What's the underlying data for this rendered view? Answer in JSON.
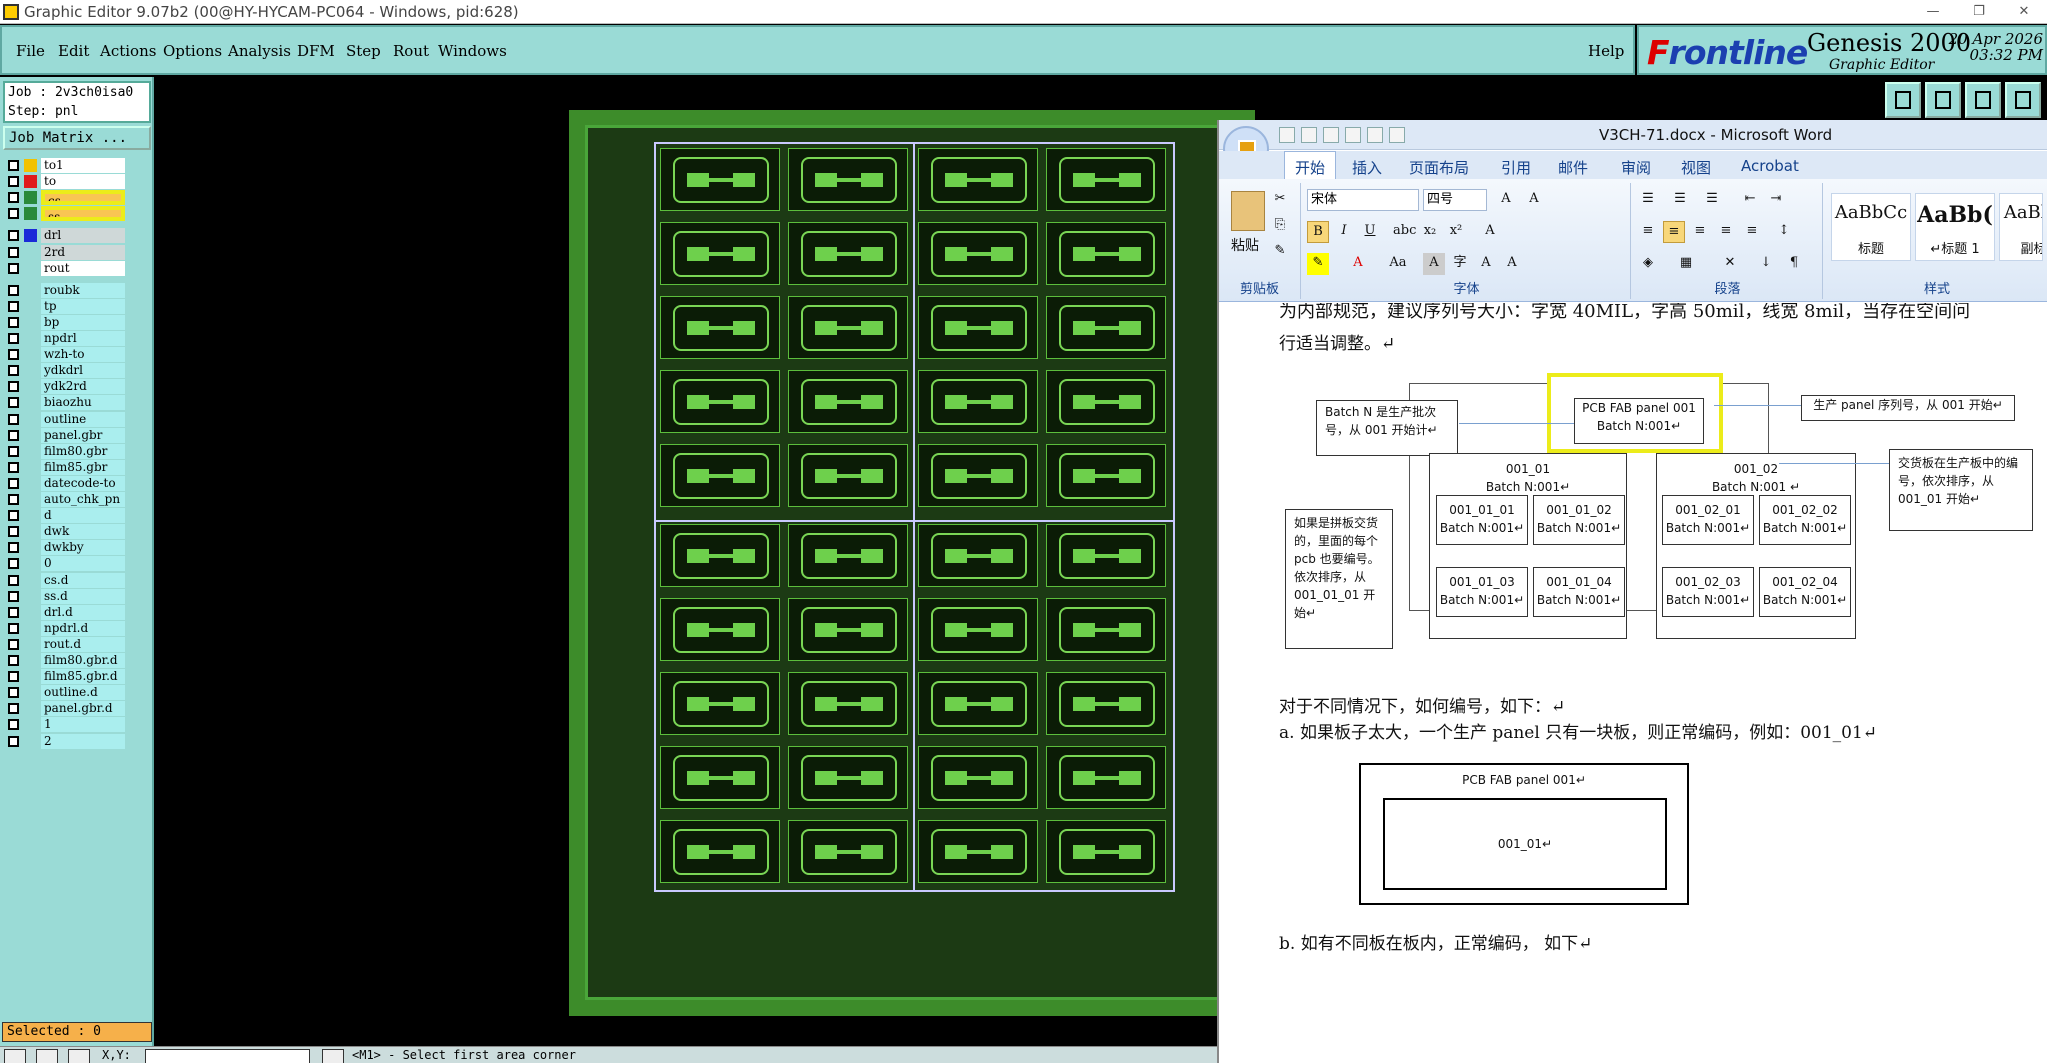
{
  "window": {
    "title": "Graphic Editor 9.07b2 (00@HY-HYCAM-PC064 - Windows, pid:628)"
  },
  "menu": [
    "File",
    "Edit",
    "Actions",
    "Options",
    "Analysis",
    "DFM",
    "Step",
    "Rout",
    "Windows"
  ],
  "help": "Help",
  "brand": {
    "logo_part1": "F",
    "logo_part2": "rontline",
    "product": "Genesis 2000",
    "subtitle": "Graphic Editor",
    "date": "20 Apr 2026",
    "time": "03:32 PM"
  },
  "job": {
    "job_line": "Job : 2v3ch0isa0",
    "step_line": "Step: pnl",
    "matrix_button": "Job Matrix ..."
  },
  "layers": [
    {
      "name": "to1",
      "color": "#f2c200",
      "style": "hl"
    },
    {
      "name": "to",
      "color": "#e01b1b",
      "style": "hl"
    },
    {
      "name": "cs",
      "color": "#2a8a3a",
      "style": "yel"
    },
    {
      "name": "ss",
      "color": "#2a8a3a",
      "style": "yel"
    },
    {
      "name": "drl",
      "color": "#1a2ad8",
      "style": "grey"
    },
    {
      "name": "2rd",
      "color": "",
      "style": "grey"
    },
    {
      "name": "rout",
      "color": "",
      "style": "hl"
    },
    {
      "name": "roubk",
      "color": "",
      "style": ""
    },
    {
      "name": "tp",
      "color": "",
      "style": ""
    },
    {
      "name": "bp",
      "color": "",
      "style": ""
    },
    {
      "name": "npdrl",
      "color": "",
      "style": ""
    },
    {
      "name": "wzh-to",
      "color": "",
      "style": ""
    },
    {
      "name": "ydkdrl",
      "color": "",
      "style": ""
    },
    {
      "name": "ydk2rd",
      "color": "",
      "style": ""
    },
    {
      "name": "biaozhu",
      "color": "",
      "style": ""
    },
    {
      "name": "outline",
      "color": "",
      "style": ""
    },
    {
      "name": "panel.gbr",
      "color": "",
      "style": ""
    },
    {
      "name": "film80.gbr",
      "color": "",
      "style": ""
    },
    {
      "name": "film85.gbr",
      "color": "",
      "style": ""
    },
    {
      "name": "datecode-to",
      "color": "",
      "style": ""
    },
    {
      "name": "auto_chk_pn",
      "color": "",
      "style": ""
    },
    {
      "name": "d",
      "color": "",
      "style": ""
    },
    {
      "name": "dwk",
      "color": "",
      "style": ""
    },
    {
      "name": "dwkby",
      "color": "",
      "style": ""
    },
    {
      "name": "0",
      "color": "",
      "style": ""
    },
    {
      "name": "cs.d",
      "color": "",
      "style": ""
    },
    {
      "name": "ss.d",
      "color": "",
      "style": ""
    },
    {
      "name": "drl.d",
      "color": "",
      "style": ""
    },
    {
      "name": "npdrl.d",
      "color": "",
      "style": ""
    },
    {
      "name": "rout.d",
      "color": "",
      "style": ""
    },
    {
      "name": "film80.gbr.d",
      "color": "",
      "style": ""
    },
    {
      "name": "film85.gbr.d",
      "color": "",
      "style": ""
    },
    {
      "name": "outline.d",
      "color": "",
      "style": ""
    },
    {
      "name": "panel.gbr.d",
      "color": "",
      "style": ""
    },
    {
      "name": "1",
      "color": "",
      "style": ""
    },
    {
      "name": "2",
      "color": "",
      "style": ""
    }
  ],
  "selected": "Selected : 0",
  "status": {
    "coord_label": "X,Y:",
    "prompt": "<M1> - Select first area corner"
  },
  "word": {
    "title": "V3CH-71.docx - Microsoft Word",
    "tabs": [
      "开始",
      "插入",
      "页面布局",
      "引用",
      "邮件",
      "审阅",
      "视图",
      "Acrobat"
    ],
    "font_name": "宋体",
    "font_size": "四号",
    "paste_label": "粘贴",
    "groups": [
      "剪贴板",
      "字体",
      "段落",
      "样式"
    ],
    "styles": [
      {
        "preview": "AaBbCc",
        "name": "标题"
      },
      {
        "preview": "AaBb(",
        "name": "↵标题 1"
      },
      {
        "preview": "AaBbCc",
        "name": "副标题"
      }
    ],
    "doc": {
      "line1": "为内部规范，建议序列号大小：字宽 40MIL，字高 50mil，线宽 8mil，当存在空间问",
      "line2": "行适当调整。↵",
      "diagram": {
        "batch_note": "Batch N 是生产批次号，从 001 开始计↵",
        "fab_box_1": "PCB FAB panel 001",
        "fab_box_2": "Batch N:001↵",
        "panel_note": "生产 panel 序列号，从 001 开始↵",
        "left_title": "001_01",
        "left_batch": "Batch N:001↵",
        "right_title": "001_02",
        "right_batch": "Batch N:001 ↵",
        "cells": [
          {
            "t": "001_01_01",
            "b": "Batch N:001↵"
          },
          {
            "t": "001_01_02",
            "b": "Batch N:001↵"
          },
          {
            "t": "001_01_03",
            "b": "Batch N:001↵"
          },
          {
            "t": "001_01_04",
            "b": "Batch N:001↵"
          },
          {
            "t": "001_02_01",
            "b": "Batch N:001↵"
          },
          {
            "t": "001_02_02",
            "b": "Batch N:001↵"
          },
          {
            "t": "001_02_03",
            "b": "Batch N:001↵"
          },
          {
            "t": "001_02_04",
            "b": "Batch N:001↵"
          }
        ],
        "delivery_note": "交货板在生产板中的编号，依次排序，从 001_01 开始↵",
        "combo_note": "如果是拼板交货的，里面的每个 pcb 也要编号。依次排序，从 001_01_01 开始↵"
      },
      "line3": "对于不同情况下，如何编号，如下：↵",
      "line4": "a.   如果板子太大，一个生产 panel 只有一块板，则正常编码，例如：001_01↵",
      "box2_title": "PCB FAB panel 001↵",
      "box2_inner": "001_01↵",
      "line5": "b.  如有不同板在板内，正常编码，  如下↵"
    }
  }
}
